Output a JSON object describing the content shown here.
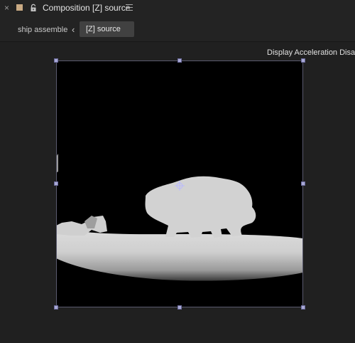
{
  "panel": {
    "close_glyph": "×",
    "label_color": "#c9aa84",
    "lock_icon": "lock-icon",
    "title": "Composition [Z] source",
    "menu_icon": "hamburger-menu-icon"
  },
  "breadcrumb": {
    "parent": "ship assemble",
    "separator": "‹",
    "current": "[Z] source"
  },
  "viewer": {
    "status": "Display Acceleration Disabled",
    "background": "#202020",
    "frame_background": "#000000",
    "handle_color": "#a9a9d6"
  }
}
